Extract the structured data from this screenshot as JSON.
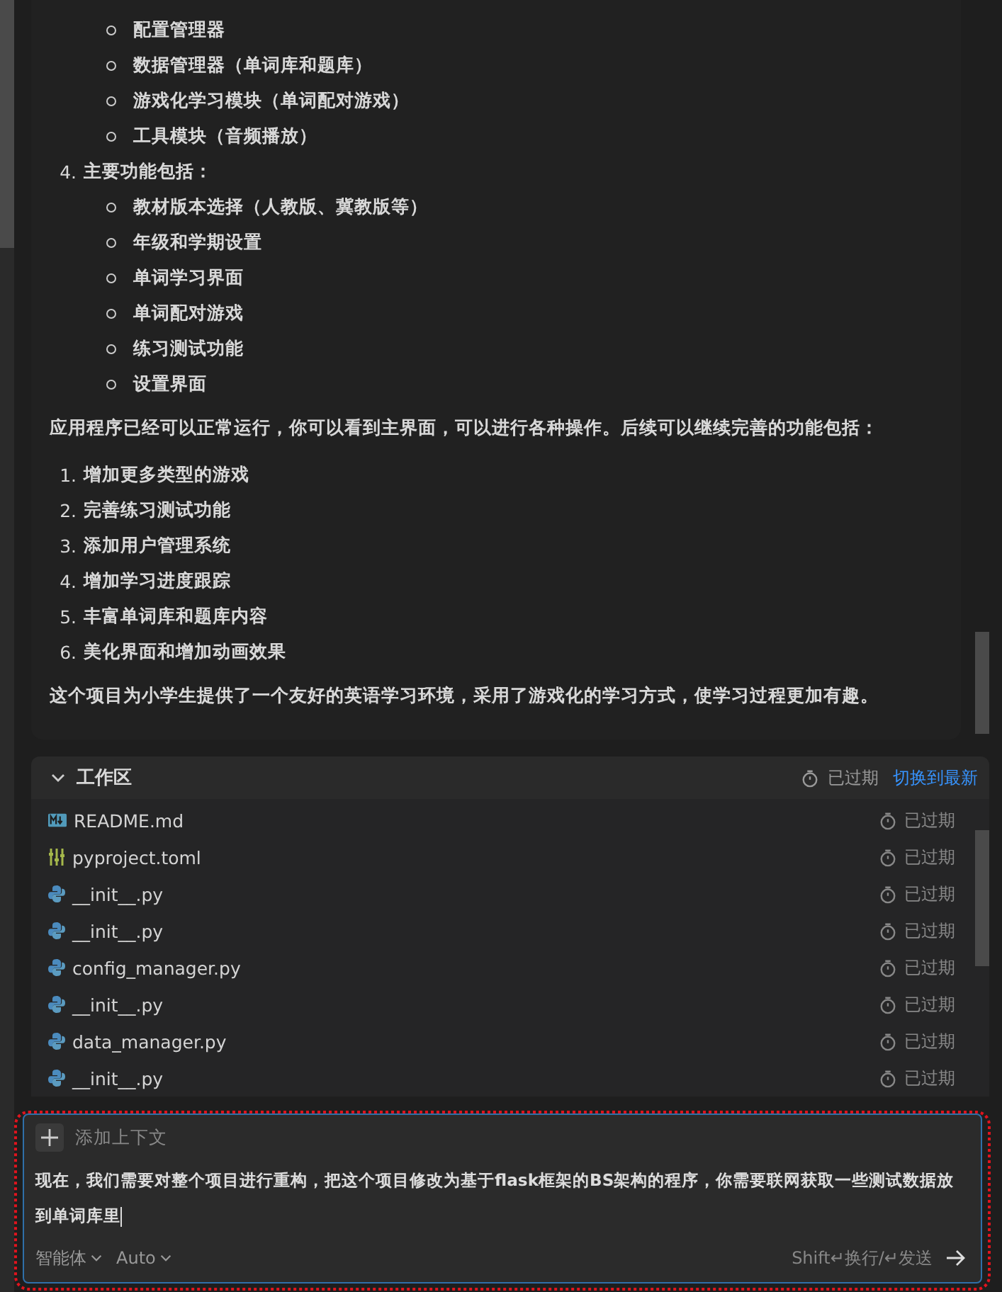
{
  "message": {
    "sublist_a": [
      "配置管理器",
      "数据管理器（单词库和题库）",
      "游戏化学习模块（单词配对游戏）",
      "工具模块（音频播放）"
    ],
    "item4": {
      "number": "4.",
      "text": "主要功能包括："
    },
    "sublist_b": [
      "教材版本选择（人教版、冀教版等）",
      "年级和学期设置",
      "单词学习界面",
      "单词配对游戏",
      "练习测试功能",
      "设置界面"
    ],
    "paragraph": "应用程序已经可以正常运行，你可以看到主界面，可以进行各种操作。后续可以继续完善的功能包括：",
    "steps": [
      {
        "number": "1.",
        "text": "增加更多类型的游戏"
      },
      {
        "number": "2.",
        "text": "完善练习测试功能"
      },
      {
        "number": "3.",
        "text": "添加用户管理系统"
      },
      {
        "number": "4.",
        "text": "增加学习进度跟踪"
      },
      {
        "number": "5.",
        "text": "丰富单词库和题库内容"
      },
      {
        "number": "6.",
        "text": "美化界面和增加动画效果"
      }
    ],
    "closing": "这个项目为小学生提供了一个友好的英语学习环境，采用了游戏化的学习方式，使学习过程更加有趣。"
  },
  "workspace": {
    "title": "工作区",
    "expanded": true,
    "status": "已过期",
    "switch_link": "切换到最新",
    "files": [
      {
        "name": "README.md",
        "kind": "markdown",
        "status": "已过期"
      },
      {
        "name": "pyproject.toml",
        "kind": "config",
        "status": "已过期"
      },
      {
        "name": "__init__.py",
        "kind": "python",
        "status": "已过期"
      },
      {
        "name": "__init__.py",
        "kind": "python",
        "status": "已过期"
      },
      {
        "name": "config_manager.py",
        "kind": "python",
        "status": "已过期"
      },
      {
        "name": "__init__.py",
        "kind": "python",
        "status": "已过期"
      },
      {
        "name": "data_manager.py",
        "kind": "python",
        "status": "已过期"
      },
      {
        "name": "__init__.py",
        "kind": "python",
        "status": "已过期"
      }
    ]
  },
  "composer": {
    "add_context": "添加上下文",
    "value": "现在，我们需要对整个项目进行重构，把这个项目修改为基于flask框架的BS架构的程序，你需要联网获取一些测试数据放到单词库里",
    "mode": "智能体",
    "model": "Auto",
    "hint": "Shift↵换行/↵发送"
  }
}
